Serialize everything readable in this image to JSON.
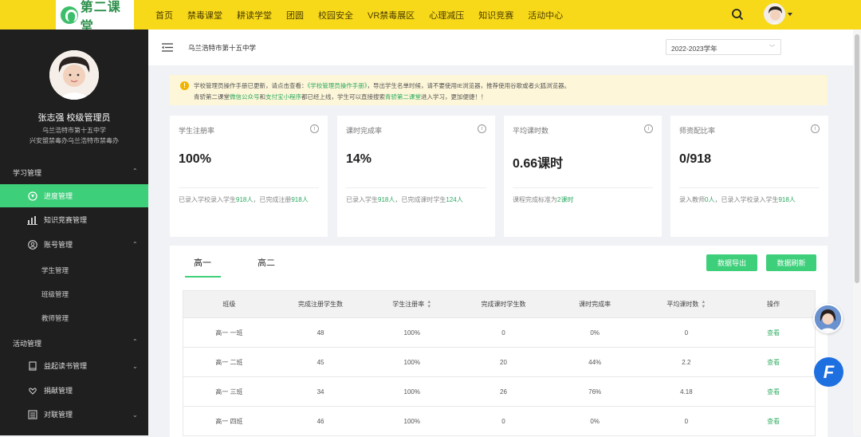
{
  "header": {
    "logo_text": "第二课堂",
    "nav": [
      "首页",
      "禁毒课堂",
      "耕读学堂",
      "团圆",
      "校园安全",
      "VR禁毒展区",
      "心理减压",
      "知识竞赛",
      "活动中心"
    ]
  },
  "sidebar": {
    "user_name": "张志强 校级管理员",
    "user_org1": "乌兰浩特市第十五中学",
    "user_org2": "兴安盟禁毒办乌兰浩特市禁毒办",
    "section1": "学习管理",
    "items1": [
      "进度管理",
      "知识竞赛管理",
      "账号管理"
    ],
    "sub_items": [
      "学生管理",
      "班级管理",
      "教师管理"
    ],
    "section2": "活动管理",
    "items2": [
      "益起读书管理",
      "捐献管理",
      "对联管理"
    ]
  },
  "main": {
    "school": "乌兰浩特市第十五中学",
    "year": "2022-2023学年",
    "notice": {
      "l1a": "学校管理员操作手册已更新，请点击查看：",
      "l1link": "《学校管理员操作手册》",
      "l1b": "，导出学生名单时候，请不要使用IE浏览器，推荐使用谷歌或者火狐浏览器。",
      "l2a": "青骄第二课堂",
      "l2link1": "微信公众号",
      "l2b": "和",
      "l2link2": "支付宝小程序",
      "l2c": "都已经上线，学生可以直接搜索",
      "l2link3": "青骄第二课堂",
      "l2d": "进入学习，更加便捷！！"
    },
    "cards": [
      {
        "label": "学生注册率",
        "value": "100%",
        "f1": "已录入学校录入学生",
        "n1": "918人",
        "f2": "，已完成注册",
        "n2": "918人"
      },
      {
        "label": "课时完成率",
        "value": "14%",
        "f1": "已录入学生",
        "n1": "918人",
        "f2": "，已完成课时学生",
        "n2": "124人"
      },
      {
        "label": "平均课时数",
        "value": "0.66课时",
        "f1": "课程完成标准为",
        "n1": "2课时",
        "f2": "",
        "n2": ""
      },
      {
        "label": "师资配比率",
        "value": "0/918",
        "f1": "录入教师",
        "n1": "0人",
        "f2": "，已录入学校录入学生",
        "n2": "918人"
      }
    ],
    "tabs": [
      "高一",
      "高二"
    ],
    "export_label": "数据导出",
    "refresh_label": "数据刷新",
    "table": {
      "headers": [
        "班级",
        "完成注册学生数",
        "学生注册率",
        "完成课时学生数",
        "课时完成率",
        "平均课时数",
        "操作"
      ],
      "rows": [
        [
          "高一 一班",
          "48",
          "100%",
          "0",
          "0%",
          "0",
          "查看"
        ],
        [
          "高一 二班",
          "45",
          "100%",
          "20",
          "44%",
          "2.2",
          "查看"
        ],
        [
          "高一 三班",
          "34",
          "100%",
          "26",
          "76%",
          "4.18",
          "查看"
        ],
        [
          "高一 四班",
          "46",
          "100%",
          "0",
          "0%",
          "0",
          "查看"
        ]
      ]
    }
  }
}
